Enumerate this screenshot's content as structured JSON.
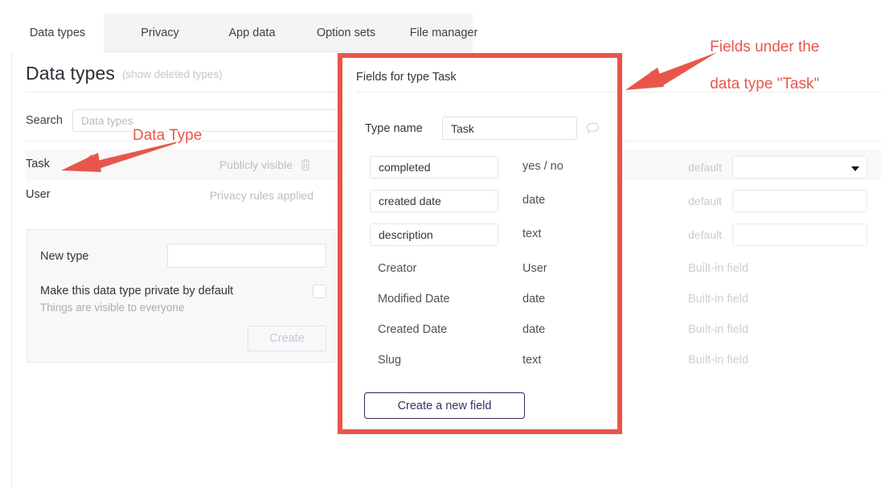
{
  "tabs": [
    {
      "label": "Data types",
      "active": true
    },
    {
      "label": "Privacy",
      "active": false
    },
    {
      "label": "App data",
      "active": false
    },
    {
      "label": "Option sets",
      "active": false
    },
    {
      "label": "File manager",
      "active": false
    }
  ],
  "header": {
    "title": "Data types",
    "show_deleted_link": "(show deleted types)"
  },
  "search": {
    "label": "Search",
    "placeholder": "Data types",
    "value": ""
  },
  "data_types": [
    {
      "name": "Task",
      "status": "Publicly visible",
      "has_delete": true
    },
    {
      "name": "User",
      "status": "Privacy rules applied",
      "has_delete": false
    }
  ],
  "new_type_card": {
    "label": "New type",
    "input_value": "",
    "input_placeholder": "",
    "private_label": "Make this data type private by default",
    "private_sublabel": "Things are visible to everyone",
    "create_button": "Create"
  },
  "fields_panel": {
    "title": "Fields for type Task",
    "type_name_label": "Type name",
    "type_name_value": "Task",
    "create_field_button": "Create a new field",
    "fields": [
      {
        "name": "completed",
        "type": "yes / no",
        "editable": true,
        "right_kind": "select",
        "right_label": "default",
        "right_value": ""
      },
      {
        "name": "created date",
        "type": "date",
        "editable": true,
        "right_kind": "input",
        "right_label": "default",
        "right_value": ""
      },
      {
        "name": "description",
        "type": "text",
        "editable": true,
        "right_kind": "input",
        "right_label": "default",
        "right_value": ""
      },
      {
        "name": "Creator",
        "type": "User",
        "editable": false,
        "right_kind": "text",
        "right_label": "Built-in field",
        "right_value": ""
      },
      {
        "name": "Modified Date",
        "type": "date",
        "editable": false,
        "right_kind": "text",
        "right_label": "Built-in field",
        "right_value": ""
      },
      {
        "name": "Created Date",
        "type": "date",
        "editable": false,
        "right_kind": "text",
        "right_label": "Built-in field",
        "right_value": ""
      },
      {
        "name": "Slug",
        "type": "text",
        "editable": false,
        "right_kind": "text",
        "right_label": "Built-in field",
        "right_value": ""
      }
    ]
  },
  "annotations": {
    "data_type": "Data Type",
    "fields_line1": "Fields under the",
    "fields_line2": "data type \"Task\"",
    "color": "#e8564b"
  }
}
